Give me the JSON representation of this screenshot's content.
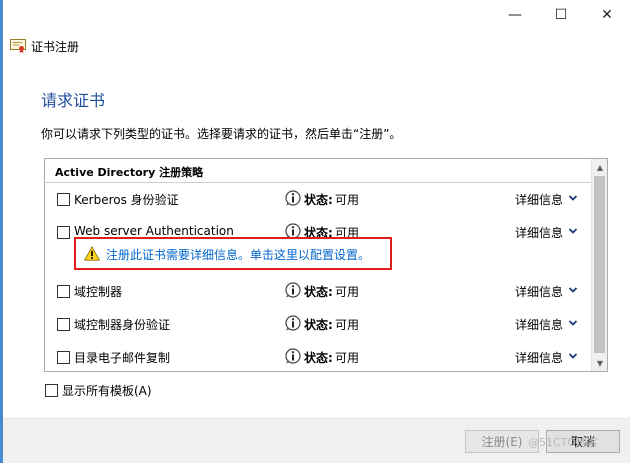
{
  "window": {
    "minimize_glyph": "—",
    "maximize_glyph": "☐",
    "close_glyph": "✕"
  },
  "breadcrumb": {
    "title": "证书注册",
    "icon": "certificate-icon"
  },
  "page": {
    "title": "请求证书",
    "instruction": "你可以请求下列类型的证书。选择要请求的证书，然后单击“注册”。"
  },
  "list": {
    "header": "Active Directory 注册策略",
    "status_label": "状态:",
    "details_label": "详细信息",
    "rows": [
      {
        "name": "Kerberos 身份验证",
        "status": "可用"
      },
      {
        "name": "Web server Authentication",
        "status": "可用"
      },
      {
        "name": "域控制器",
        "status": "可用"
      },
      {
        "name": "域控制器身份验证",
        "status": "可用"
      },
      {
        "name": "目录电子邮件复制",
        "status": "可用"
      }
    ],
    "warning_link": "注册此证书需要详细信息。单击这里以配置设置。"
  },
  "show_all": {
    "label": "显示所有模板(A)"
  },
  "footer": {
    "register_label": "注册(E)",
    "cancel_label": "取消"
  },
  "watermark": "@51CTO博客",
  "colors": {
    "accent_title": "#1f4e9c",
    "link": "#0066cc",
    "highlight_border": "#e11d1d"
  }
}
